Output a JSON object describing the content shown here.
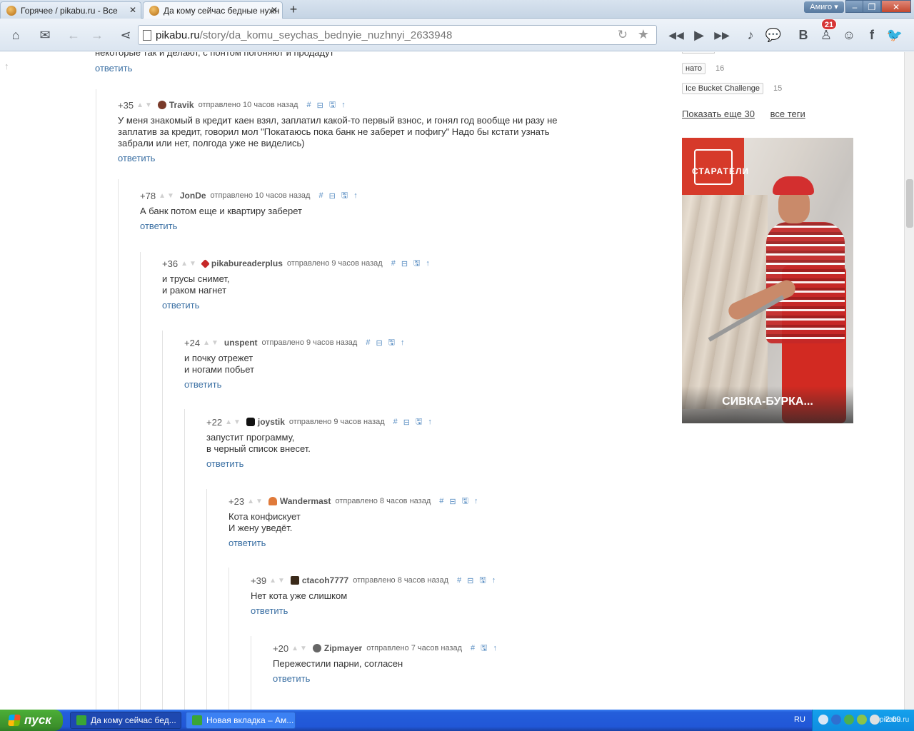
{
  "browser": {
    "tabs": [
      {
        "title": "Горячее / pikabu.ru - Все"
      },
      {
        "title": "Да кому сейчас бедные нужн"
      }
    ],
    "new_tab": "+",
    "profile": "Амиго ▾",
    "url_domain": "pikabu.ru",
    "url_path": "/story/da_komu_seychas_bednyie_nuzhnyi_2633948",
    "notification_badge": "21",
    "window_controls": {
      "minimize": "–",
      "restore": "❐",
      "close": "✕"
    }
  },
  "page": {
    "cut_text": "некоторые так и делают, с понтом погоняют и продадут",
    "top_reply": "ответить",
    "comments": [
      {
        "rating": "+35",
        "author": "Travik",
        "time": "отправлено 10 часов назад",
        "text": "У меня знакомый в кредит каен взял, заплатил какой-то первый взнос, и гонял год вообще ни разу не\nзаплатив за кредит, говорил мол \"Покатаюсь пока банк не заберет и пофигу\" Надо бы кстати узнать\nзабрали или нет, полгода уже не виделись)",
        "reply": "ответить",
        "avatar_color": "#7a3b2a"
      },
      {
        "rating": "+78",
        "author": "JonDe",
        "time": "отправлено 10 часов назад",
        "text": "А банк потом еще и квартиру заберет",
        "reply": "ответить",
        "avatar_color": ""
      },
      {
        "rating": "+36",
        "author": "pikabureaderplus",
        "time": "отправлено 9 часов назад",
        "text": "и трусы снимет,\nи раком нагнет",
        "reply": "ответить",
        "avatar_color": "#c62828"
      },
      {
        "rating": "+24",
        "author": "unspent",
        "time": "отправлено 9 часов назад",
        "text": "и почку отрежет\nи ногами побьет",
        "reply": "ответить",
        "avatar_color": ""
      },
      {
        "rating": "+22",
        "author": "joystik",
        "time": "отправлено 9 часов назад",
        "text": "запустит программу,\nв черный список внесет.",
        "reply": "ответить",
        "avatar_color": "#111111"
      },
      {
        "rating": "+23",
        "author": "Wandermast",
        "time": "отправлено 8 часов назад",
        "text": "Кота конфискует\nИ жену уведёт.",
        "reply": "ответить",
        "avatar_color": "#e07a3a"
      },
      {
        "rating": "+39",
        "author": "ctacoh7777",
        "time": "отправлено 8 часов назад",
        "text": "Нет кота уже слишком",
        "reply": "ответить",
        "avatar_color": "#3a2a1a"
      },
      {
        "rating": "+20",
        "author": "Zipmayer",
        "time": "отправлено 7 часов назад",
        "text": "Пережестили парни, согласен",
        "reply": "ответить",
        "avatar_color": "#666666"
      }
    ],
    "actions": {
      "hash": "#",
      "collapse": "⊟",
      "save": "🖫",
      "up": "↑"
    },
    "sidebar": {
      "tags": [
        {
          "name": "нато",
          "count": "16"
        },
        {
          "name": "Ice Bucket Challenge",
          "count": "15"
        }
      ],
      "show_more": "Показать еще 30",
      "all_tags": "все теги",
      "ad": {
        "logo": "СТАРАТЕЛИ",
        "caption": "СИВКА-БУРКА..."
      }
    }
  },
  "taskbar": {
    "start": "пуск",
    "tasks": [
      {
        "title": "Да кому сейчас бед..."
      },
      {
        "title": "Новая вкладка – Ам..."
      }
    ],
    "lang": "RU",
    "clock": "2:09",
    "watermark": "pikabu.ru"
  }
}
